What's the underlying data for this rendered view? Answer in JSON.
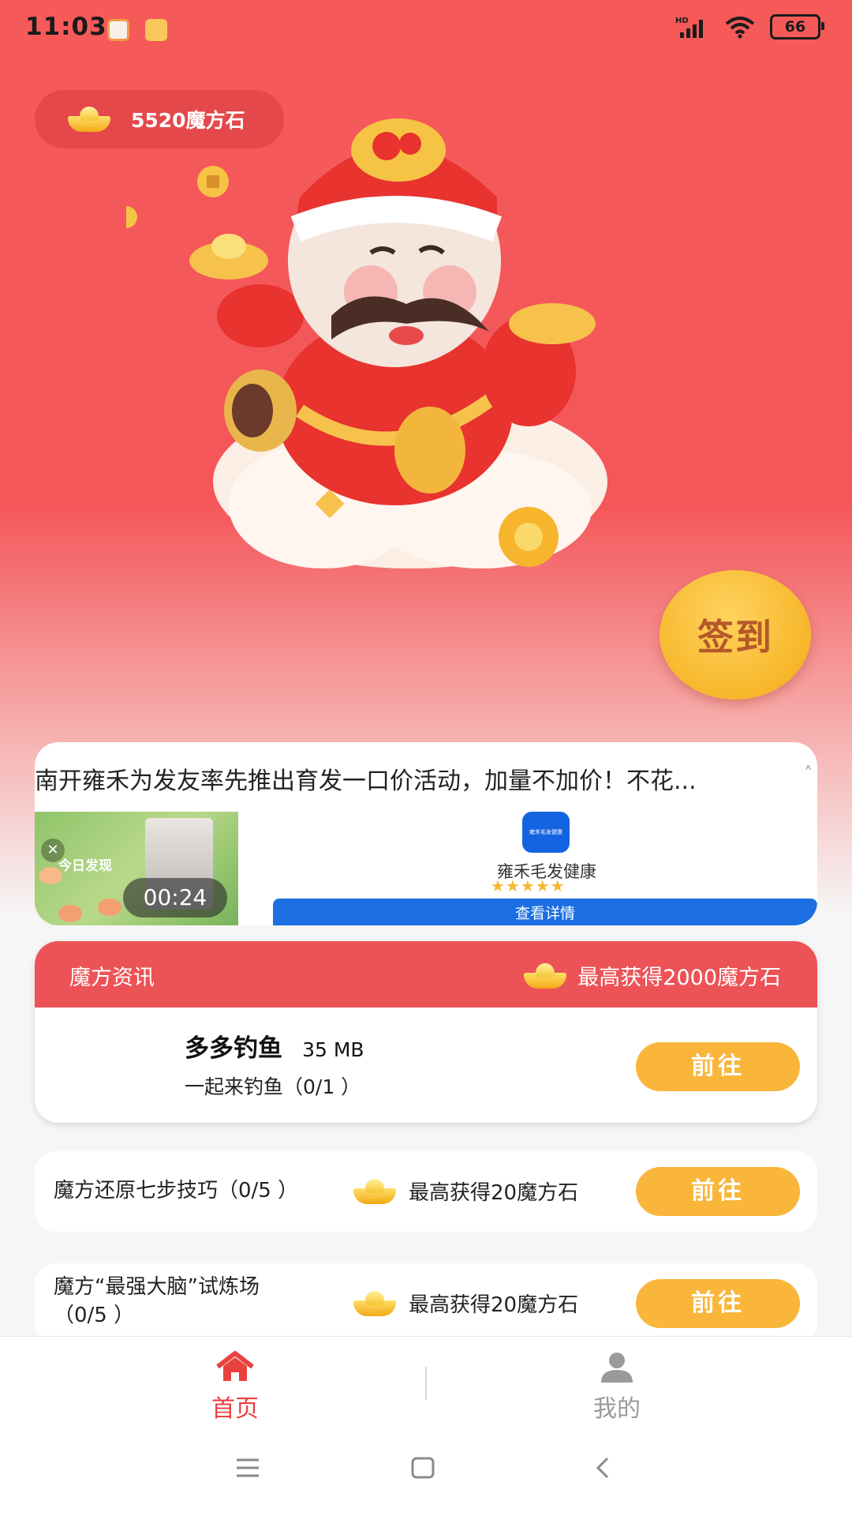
{
  "status_bar": {
    "time": "11:03",
    "battery": "66",
    "notification_icons": [
      "notification-app-icon",
      "gallery-icon"
    ],
    "signal_icons": [
      "hd-signal-icon",
      "wifi-icon",
      "battery-icon"
    ]
  },
  "balance": {
    "text": "5520魔方石",
    "icon": "gold-ingot-icon"
  },
  "signin": {
    "label": "签到"
  },
  "ad": {
    "headline": "南开雍禾为发友率先推出育发一口价活动，加量不加价！不花...",
    "video_label": "今日发现",
    "video_timer": "00:24",
    "app_logo_text": "雍禾毛发健康",
    "app_name": "雍禾毛发健康",
    "stars": "★★★★★",
    "cta": "查看详情"
  },
  "info_card": {
    "title": "魔方资讯",
    "reward": "最高获得2000魔方石",
    "app_name": "多多钓鱼",
    "app_size": "35 MB",
    "app_desc": "一起来钓鱼（0/1 ）",
    "button": "前往"
  },
  "tasks": [
    {
      "label": "魔方还原七步技巧（0/5 ）",
      "reward": "最高获得20魔方石",
      "button": "前往"
    },
    {
      "label_line1": "魔方“最强大脑”试炼场",
      "label_line2": "（0/5 ）",
      "reward": "最高获得20魔方石",
      "button": "前往"
    }
  ],
  "tabbar": {
    "items": [
      {
        "label": "首页",
        "icon": "home-icon",
        "active": true
      },
      {
        "label": "我的",
        "icon": "user-icon",
        "active": false
      }
    ]
  },
  "colors": {
    "primary_red": "#f4565a",
    "header_red": "#ec5357",
    "gold": "#f9b63b",
    "active_tab": "#e8423f",
    "inactive_tab": "#9a9a9a",
    "ad_blue": "#1b6fe3"
  }
}
